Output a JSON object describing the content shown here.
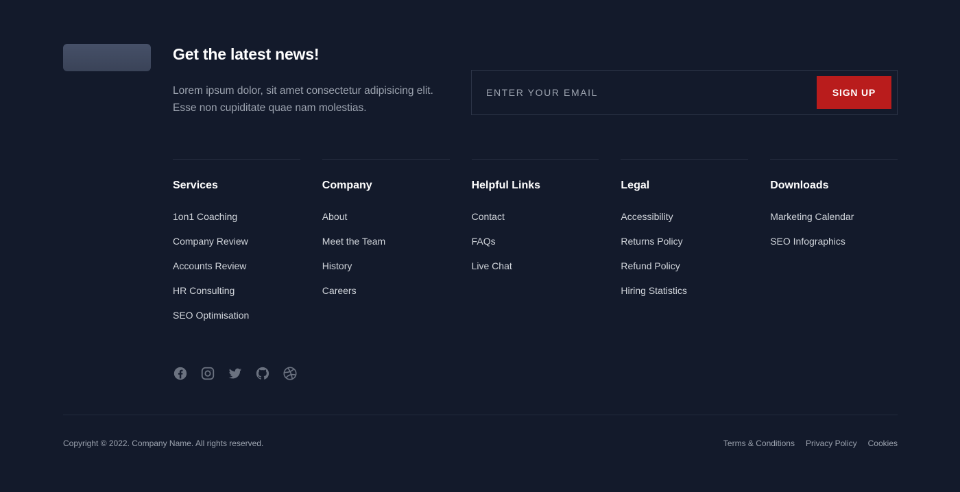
{
  "newsletter": {
    "title": "Get the latest news!",
    "text": "Lorem ipsum dolor, sit amet consectetur adipisicing elit. Esse non cupiditate quae nam molestias.",
    "email_placeholder": "ENTER YOUR EMAIL",
    "signup_label": "SIGN UP"
  },
  "columns": [
    {
      "title": "Services",
      "items": [
        "1on1 Coaching",
        "Company Review",
        "Accounts Review",
        "HR Consulting",
        "SEO Optimisation"
      ]
    },
    {
      "title": "Company",
      "items": [
        "About",
        "Meet the Team",
        "History",
        "Careers"
      ]
    },
    {
      "title": "Helpful Links",
      "items": [
        "Contact",
        "FAQs",
        "Live Chat"
      ]
    },
    {
      "title": "Legal",
      "items": [
        "Accessibility",
        "Returns Policy",
        "Refund Policy",
        "Hiring Statistics"
      ]
    },
    {
      "title": "Downloads",
      "items": [
        "Marketing Calendar",
        "SEO Infographics"
      ]
    }
  ],
  "socials": [
    "facebook-icon",
    "instagram-icon",
    "twitter-icon",
    "github-icon",
    "dribbble-icon"
  ],
  "bottom": {
    "copyright": "Copyright © 2022. Company Name. All rights reserved.",
    "links": [
      "Terms & Conditions",
      "Privacy Policy",
      "Cookies"
    ]
  },
  "colors": {
    "background": "#131a2b",
    "accent": "#b91c1c",
    "icon": "#6b7280"
  }
}
